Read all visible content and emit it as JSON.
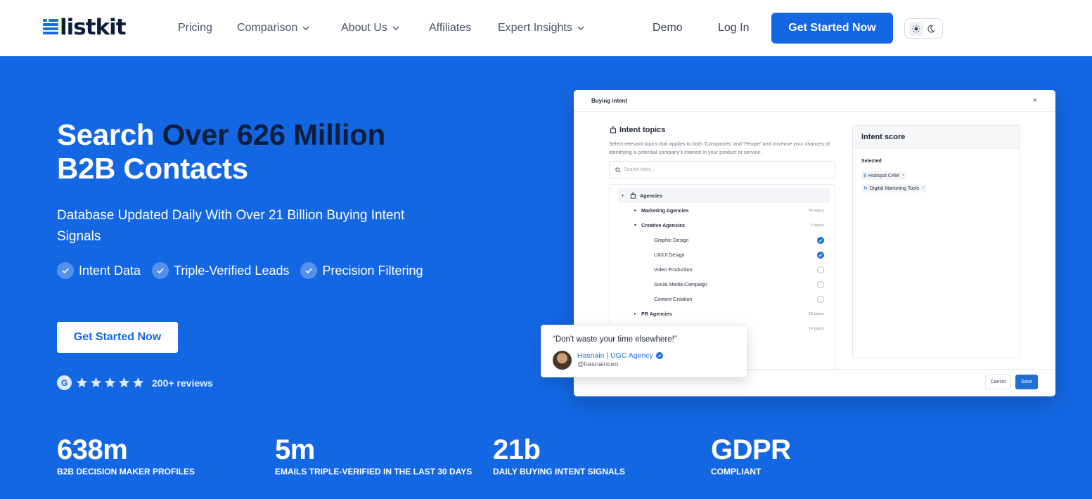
{
  "nav": {
    "logo_text": "listkit",
    "items": [
      {
        "label": "Pricing",
        "has_dropdown": false
      },
      {
        "label": "Comparison",
        "has_dropdown": true
      },
      {
        "label": "About Us",
        "has_dropdown": true
      },
      {
        "label": "Affiliates",
        "has_dropdown": false
      },
      {
        "label": "Expert Insights",
        "has_dropdown": true
      }
    ],
    "demo": "Demo",
    "login": "Log In",
    "cta": "Get Started Now",
    "theme_icons": [
      "sun-icon",
      "moon-icon"
    ]
  },
  "hero": {
    "title_light": "Search ",
    "title_dark": "Over 626 Million",
    "title_line2": "B2B Contacts",
    "subtitle": "Database Updated Daily With Over 21 Billion Buying Intent Signals",
    "checks": [
      "Intent Data",
      "Triple-Verified Leads",
      "Precision Filtering"
    ],
    "cta": "Get Started Now",
    "reviews_badge": "G",
    "stars": 5,
    "reviews_text": "200+ reviews"
  },
  "stats": [
    {
      "value": "638m",
      "label": "B2B DECISION MAKER PROFILES"
    },
    {
      "value": "5m",
      "label": "EMAILS TRIPLE-VERIFIED IN THE LAST 30 DAYS"
    },
    {
      "value": "21b",
      "label": "DAILY BUYING INTENT SIGNALS"
    },
    {
      "value": "GDPR",
      "label": "COMPLIANT"
    }
  ],
  "mockup": {
    "title": "Buying intent",
    "close": "×",
    "intent_title": "Intent topics",
    "intent_desc": "Select relevant topics that applies to both 'Companies' and 'People' and increase your chances of identifying a potential company's interest in your product or service.",
    "search_placeholder": "Search topic...",
    "tree": {
      "agencies": "Agencies",
      "marketing": {
        "label": "Marketing Agencies",
        "count": "56 topics"
      },
      "creative": {
        "label": "Creative Agencies",
        "count": "5 topics"
      },
      "leaves": [
        {
          "label": "Graphic Design",
          "checked": true
        },
        {
          "label": "UX/UI Design",
          "checked": true
        },
        {
          "label": "Video Production",
          "checked": false
        },
        {
          "label": "Social Media Campaign",
          "checked": false
        },
        {
          "label": "Content Creation",
          "checked": false
        }
      ],
      "pr": {
        "label": "PR Agencies",
        "count": "23 topics"
      },
      "hidden_count": "14 topics"
    },
    "score_title": "Intent score",
    "selected_label": "Selected",
    "chips": [
      "Hubspot CRM",
      "Digital Marketing Tools"
    ],
    "cancel": "Cancel",
    "save": "Save"
  },
  "testimonial": {
    "quote": "“Don't waste your time elsewhere!”",
    "name": "Hasnain | UGC Agency",
    "handle": "@hasnainceo"
  },
  "colors": {
    "brand_blue": "#1467e3",
    "dark_navy": "#0d1e3f",
    "white": "#ffffff"
  }
}
